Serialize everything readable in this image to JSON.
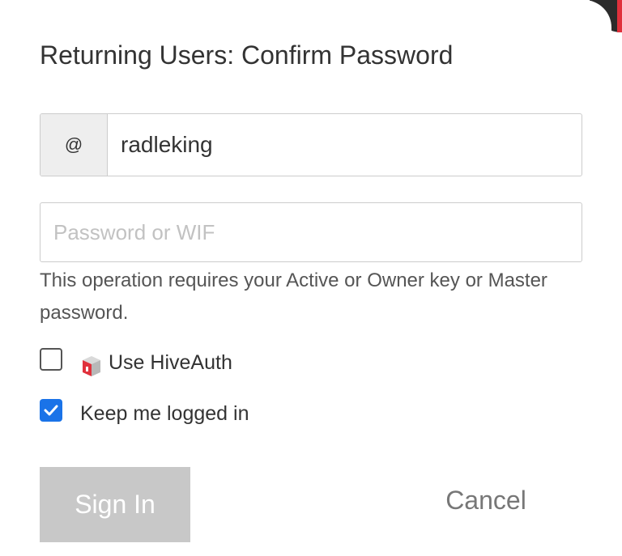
{
  "dialog": {
    "title": "Returning Users: Confirm Password"
  },
  "username_field": {
    "prefix": "@",
    "value": "radleking"
  },
  "password_field": {
    "placeholder": "Password or WIF"
  },
  "help_text": "This operation requires your Active or Owner key or Master password.",
  "options": {
    "hiveauth": {
      "label": "Use HiveAuth",
      "checked": false,
      "icon": "hiveauth-logo-icon"
    },
    "keep_logged_in": {
      "label": "Keep me logged in",
      "checked": true
    }
  },
  "buttons": {
    "signin_label": "Sign In",
    "cancel_label": "Cancel"
  },
  "colors": {
    "checkbox_checked": "#1a73e8",
    "signin_disabled_bg": "#c8c8c8",
    "hive_red": "#e0313c"
  }
}
